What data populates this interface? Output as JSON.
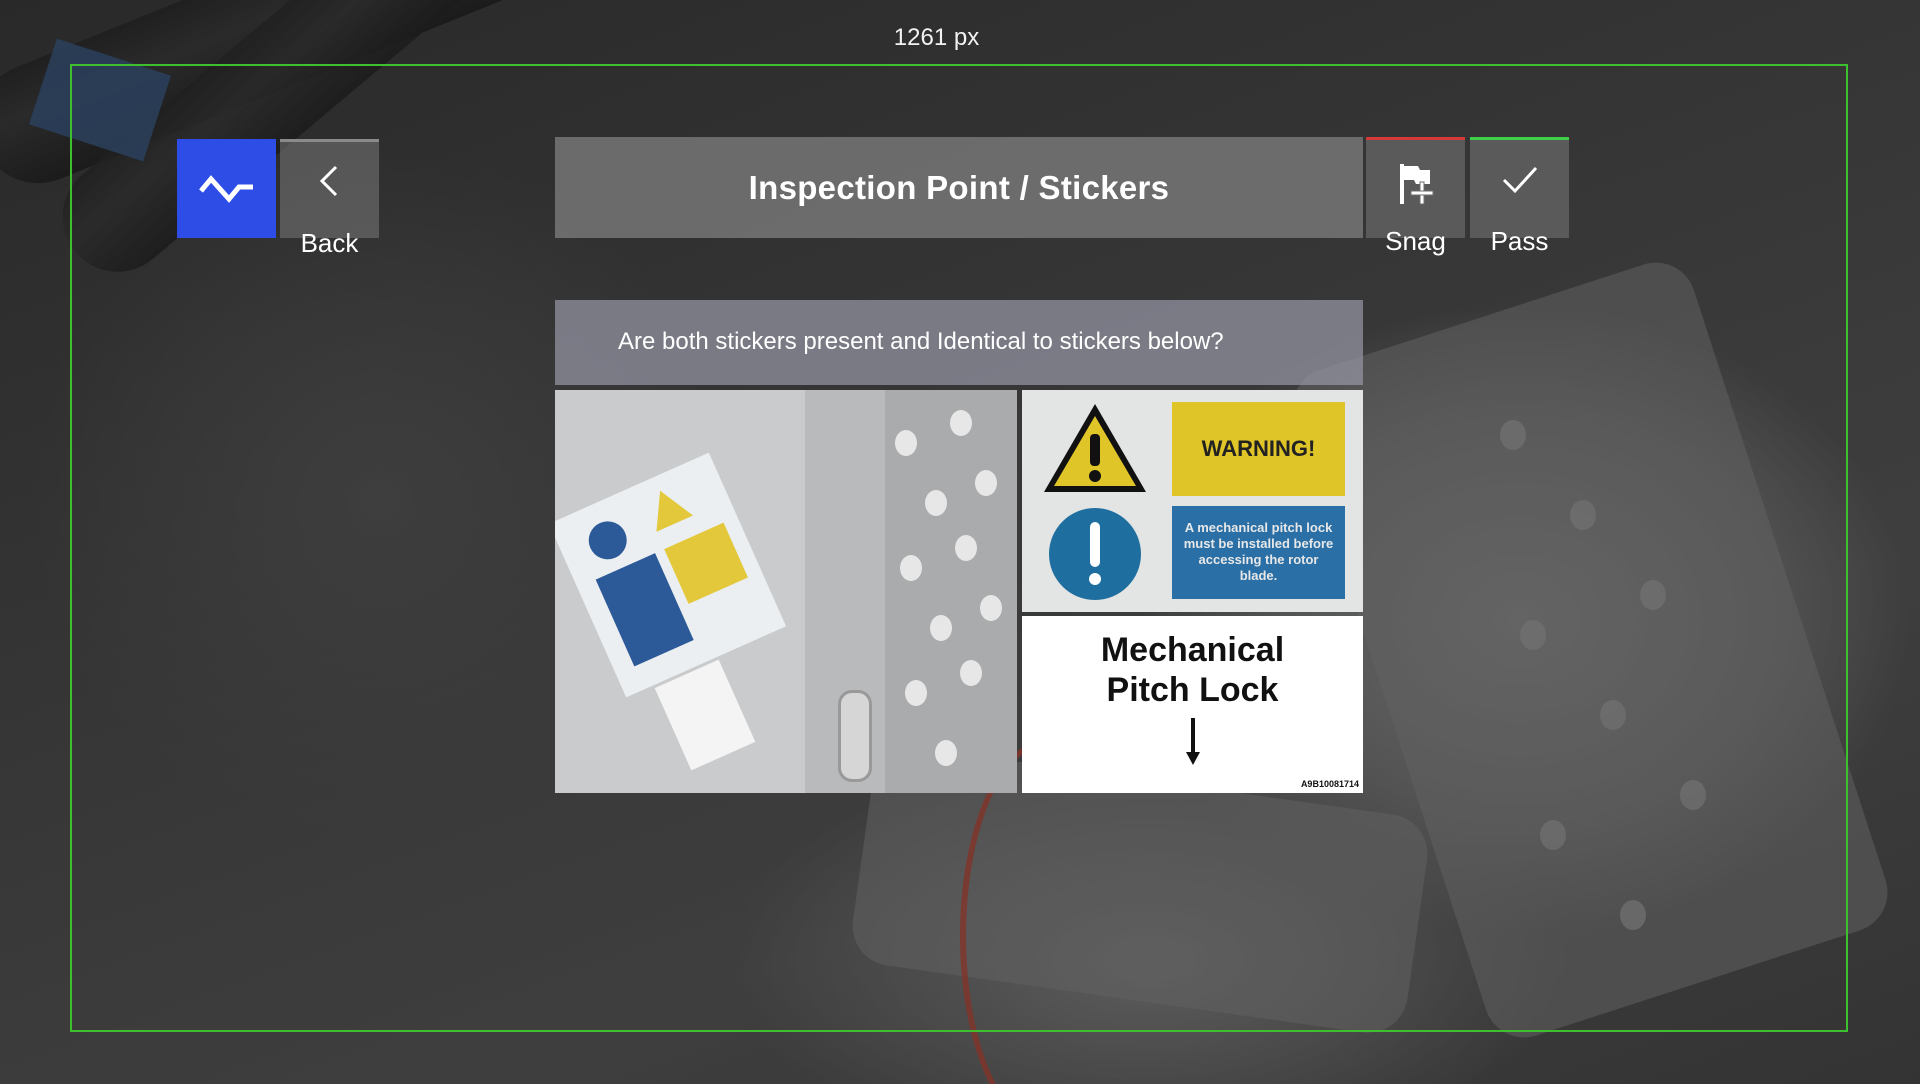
{
  "overlay": {
    "measure_label": "1261 px",
    "frame_color": "#3fbf2f"
  },
  "nav": {
    "home_icon": "home-icon",
    "back_label": "Back",
    "back_icon": "chevron-left-icon"
  },
  "header": {
    "title": "Inspection Point / Stickers"
  },
  "actions": {
    "snag_label": "Snag",
    "snag_icon": "flag-plus-icon",
    "snag_accent": "#d43a3a",
    "pass_label": "Pass",
    "pass_icon": "check-icon",
    "pass_accent": "#3fd04a"
  },
  "question": {
    "text": "Are both stickers present and Identical to stickers below?"
  },
  "reference": {
    "warning_text": "WARNING!",
    "instruction_text": "A mechanical pitch lock must be installed before accessing the rotor blade.",
    "label_line1": "Mechanical",
    "label_line2": "Pitch Lock",
    "label_code": "A9B10081714"
  },
  "colors": {
    "home_button": "#2e4de6",
    "warning_yellow": "#e0c528",
    "info_blue": "#2a6fa5"
  }
}
